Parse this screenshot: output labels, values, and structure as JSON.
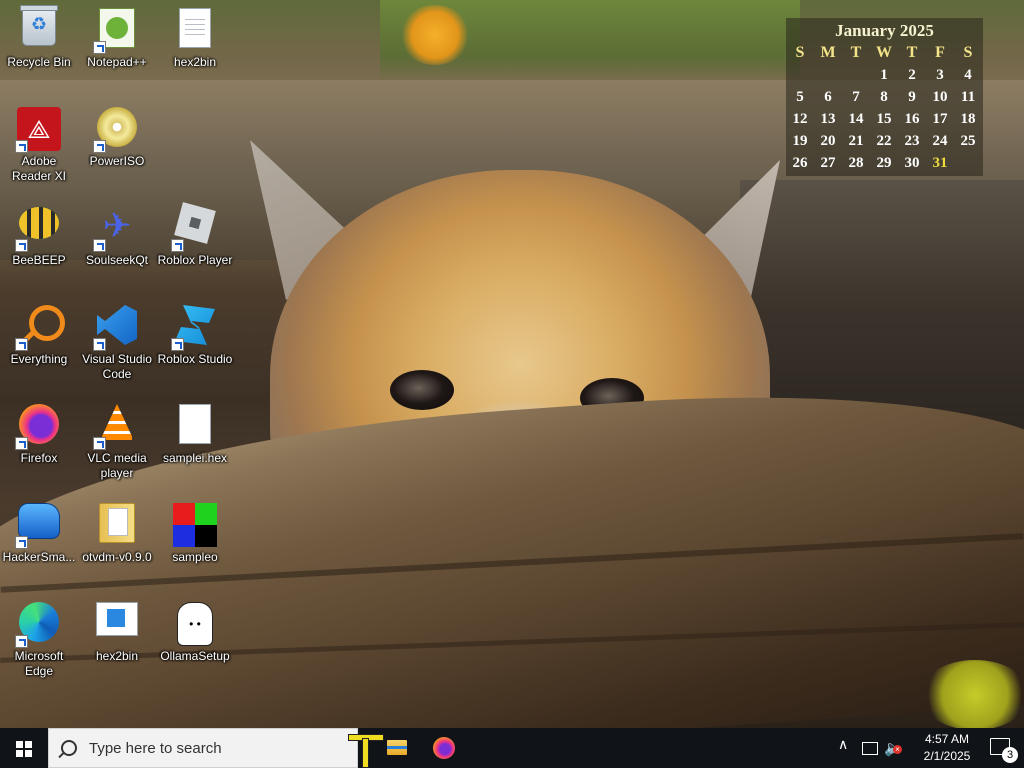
{
  "desktop": {
    "icons": [
      {
        "label": "Recycle Bin"
      },
      {
        "label": "Notepad++"
      },
      {
        "label": "hex2bin"
      },
      {
        "label": "Adobe Reader XI"
      },
      {
        "label": "PowerISO"
      },
      {
        "label": "BeeBEEP"
      },
      {
        "label": "SoulseekQt"
      },
      {
        "label": "Roblox Player"
      },
      {
        "label": "Everything"
      },
      {
        "label": "Visual Studio Code"
      },
      {
        "label": "Roblox Studio"
      },
      {
        "label": "Firefox"
      },
      {
        "label": "VLC media player"
      },
      {
        "label": "samplei.hex"
      },
      {
        "label": "HackerSma..."
      },
      {
        "label": "otvdm-v0.9.0"
      },
      {
        "label": "sampleo"
      },
      {
        "label": "Microsoft Edge"
      },
      {
        "label": "hex2bin"
      },
      {
        "label": "OllamaSetup"
      }
    ]
  },
  "calendar": {
    "title": "January 2025",
    "weekdays": [
      "S",
      "M",
      "T",
      "W",
      "T",
      "F",
      "S"
    ],
    "rows": [
      [
        "",
        "",
        "",
        "1",
        "2",
        "3",
        "4"
      ],
      [
        "5",
        "6",
        "7",
        "8",
        "9",
        "10",
        "11"
      ],
      [
        "12",
        "13",
        "14",
        "15",
        "16",
        "17",
        "18"
      ],
      [
        "19",
        "20",
        "21",
        "22",
        "23",
        "24",
        "25"
      ],
      [
        "26",
        "27",
        "28",
        "29",
        "30",
        "31",
        ""
      ]
    ],
    "highlighted_day": "31",
    "highlight_color": "#f0dc3a"
  },
  "taskbar": {
    "search_placeholder": "Type here to search",
    "pinned": [
      "text-cursor-app",
      "file-explorer",
      "firefox"
    ],
    "tray": {
      "time": "4:57 AM",
      "date": "2/1/2025",
      "notification_count": "3"
    }
  }
}
